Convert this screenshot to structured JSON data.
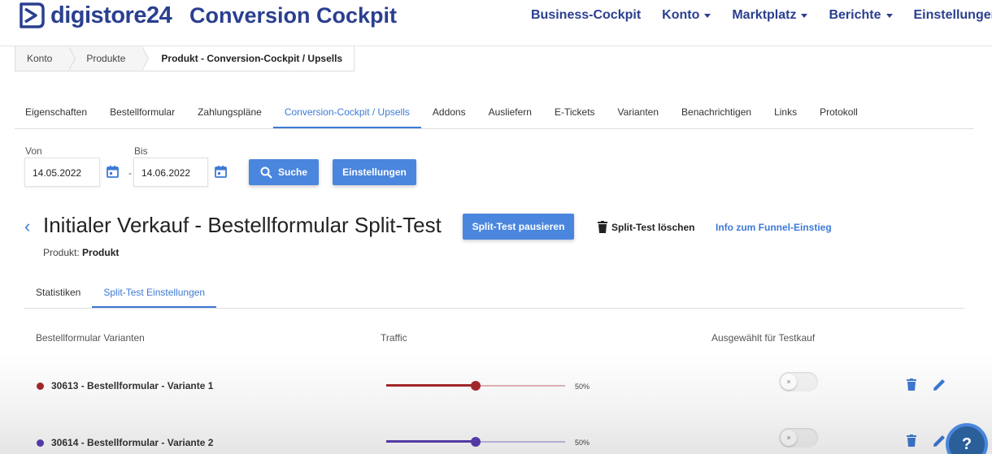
{
  "header": {
    "logo_text": "digistore24",
    "app_title": "Conversion Cockpit",
    "nav": [
      {
        "label": "Business-Cockpit",
        "dropdown": false
      },
      {
        "label": "Konto",
        "dropdown": true
      },
      {
        "label": "Marktplatz",
        "dropdown": true
      },
      {
        "label": "Berichte",
        "dropdown": true
      },
      {
        "label": "Einstellungen",
        "dropdown": true
      }
    ]
  },
  "breadcrumb": [
    "Konto",
    "Produkte",
    "Produkt - Conversion-Cockpit / Upsells"
  ],
  "tabs": [
    {
      "label": "Eigenschaften",
      "active": false
    },
    {
      "label": "Bestellformular",
      "active": false
    },
    {
      "label": "Zahlungspläne",
      "active": false
    },
    {
      "label": "Conversion-Cockpit / Upsells",
      "active": true
    },
    {
      "label": "Addons",
      "active": false
    },
    {
      "label": "Ausliefern",
      "active": false
    },
    {
      "label": "E-Tickets",
      "active": false
    },
    {
      "label": "Varianten",
      "active": false
    },
    {
      "label": "Benachrichtigen",
      "active": false
    },
    {
      "label": "Links",
      "active": false
    },
    {
      "label": "Protokoll",
      "active": false
    }
  ],
  "filter": {
    "from_label": "Von",
    "to_label": "Bis",
    "from_value": "14.05.2022",
    "to_value": "14.06.2022",
    "separator": "-",
    "search_label": "Suche",
    "settings_label": "Einstellungen"
  },
  "funnel": {
    "back_glyph": "‹",
    "title": "Initialer Verkauf - Bestellformular Split-Test",
    "pause_label": "Split-Test pausieren",
    "delete_label": "Split-Test löschen",
    "info_label": "Info zum Funnel-Einstieg",
    "product_prefix": "Produkt:",
    "product_name": "Produkt"
  },
  "subtabs": [
    {
      "label": "Statistiken",
      "active": false
    },
    {
      "label": "Split-Test Einstellungen",
      "active": true
    }
  ],
  "table": {
    "headers": {
      "variants": "Bestellformular Varianten",
      "traffic": "Traffic",
      "selected": "Ausgewählt für Testkauf"
    },
    "rows": [
      {
        "name": "30613 - Bestellformular - Variante 1",
        "traffic": 50,
        "traffic_label": "50%",
        "color": "#a5282a",
        "selected": false,
        "toggle_glyph": "×"
      },
      {
        "name": "30614 - Bestellformular - Variante 2",
        "traffic": 50,
        "traffic_label": "50%",
        "color": "#5b3fb5",
        "selected": false,
        "toggle_glyph": "×"
      }
    ]
  },
  "colors": {
    "brand": "#2a3f8f",
    "accent": "#3d7ad6",
    "button": "#4a86de"
  },
  "help_glyph": "?"
}
